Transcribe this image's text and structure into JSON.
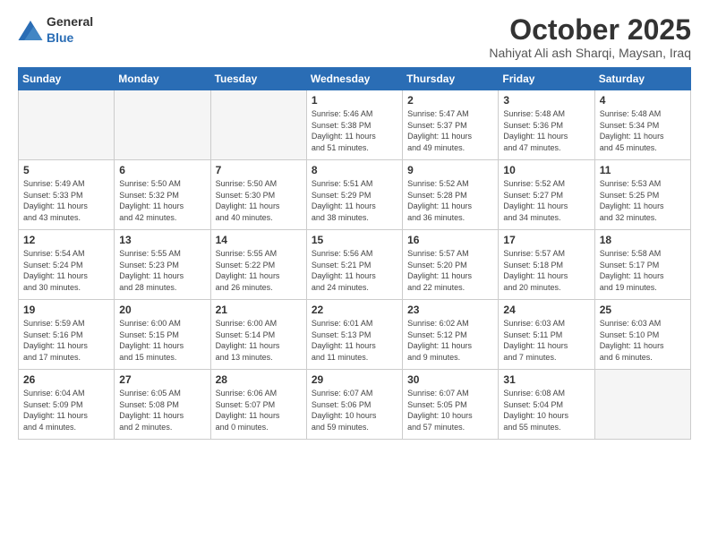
{
  "logo": {
    "text_general": "General",
    "text_blue": "Blue"
  },
  "title": "October 2025",
  "location": "Nahiyat Ali ash Sharqi, Maysan, Iraq",
  "weekdays": [
    "Sunday",
    "Monday",
    "Tuesday",
    "Wednesday",
    "Thursday",
    "Friday",
    "Saturday"
  ],
  "weeks": [
    [
      {
        "day": "",
        "info": ""
      },
      {
        "day": "",
        "info": ""
      },
      {
        "day": "",
        "info": ""
      },
      {
        "day": "1",
        "info": "Sunrise: 5:46 AM\nSunset: 5:38 PM\nDaylight: 11 hours\nand 51 minutes."
      },
      {
        "day": "2",
        "info": "Sunrise: 5:47 AM\nSunset: 5:37 PM\nDaylight: 11 hours\nand 49 minutes."
      },
      {
        "day": "3",
        "info": "Sunrise: 5:48 AM\nSunset: 5:36 PM\nDaylight: 11 hours\nand 47 minutes."
      },
      {
        "day": "4",
        "info": "Sunrise: 5:48 AM\nSunset: 5:34 PM\nDaylight: 11 hours\nand 45 minutes."
      }
    ],
    [
      {
        "day": "5",
        "info": "Sunrise: 5:49 AM\nSunset: 5:33 PM\nDaylight: 11 hours\nand 43 minutes."
      },
      {
        "day": "6",
        "info": "Sunrise: 5:50 AM\nSunset: 5:32 PM\nDaylight: 11 hours\nand 42 minutes."
      },
      {
        "day": "7",
        "info": "Sunrise: 5:50 AM\nSunset: 5:30 PM\nDaylight: 11 hours\nand 40 minutes."
      },
      {
        "day": "8",
        "info": "Sunrise: 5:51 AM\nSunset: 5:29 PM\nDaylight: 11 hours\nand 38 minutes."
      },
      {
        "day": "9",
        "info": "Sunrise: 5:52 AM\nSunset: 5:28 PM\nDaylight: 11 hours\nand 36 minutes."
      },
      {
        "day": "10",
        "info": "Sunrise: 5:52 AM\nSunset: 5:27 PM\nDaylight: 11 hours\nand 34 minutes."
      },
      {
        "day": "11",
        "info": "Sunrise: 5:53 AM\nSunset: 5:25 PM\nDaylight: 11 hours\nand 32 minutes."
      }
    ],
    [
      {
        "day": "12",
        "info": "Sunrise: 5:54 AM\nSunset: 5:24 PM\nDaylight: 11 hours\nand 30 minutes."
      },
      {
        "day": "13",
        "info": "Sunrise: 5:55 AM\nSunset: 5:23 PM\nDaylight: 11 hours\nand 28 minutes."
      },
      {
        "day": "14",
        "info": "Sunrise: 5:55 AM\nSunset: 5:22 PM\nDaylight: 11 hours\nand 26 minutes."
      },
      {
        "day": "15",
        "info": "Sunrise: 5:56 AM\nSunset: 5:21 PM\nDaylight: 11 hours\nand 24 minutes."
      },
      {
        "day": "16",
        "info": "Sunrise: 5:57 AM\nSunset: 5:20 PM\nDaylight: 11 hours\nand 22 minutes."
      },
      {
        "day": "17",
        "info": "Sunrise: 5:57 AM\nSunset: 5:18 PM\nDaylight: 11 hours\nand 20 minutes."
      },
      {
        "day": "18",
        "info": "Sunrise: 5:58 AM\nSunset: 5:17 PM\nDaylight: 11 hours\nand 19 minutes."
      }
    ],
    [
      {
        "day": "19",
        "info": "Sunrise: 5:59 AM\nSunset: 5:16 PM\nDaylight: 11 hours\nand 17 minutes."
      },
      {
        "day": "20",
        "info": "Sunrise: 6:00 AM\nSunset: 5:15 PM\nDaylight: 11 hours\nand 15 minutes."
      },
      {
        "day": "21",
        "info": "Sunrise: 6:00 AM\nSunset: 5:14 PM\nDaylight: 11 hours\nand 13 minutes."
      },
      {
        "day": "22",
        "info": "Sunrise: 6:01 AM\nSunset: 5:13 PM\nDaylight: 11 hours\nand 11 minutes."
      },
      {
        "day": "23",
        "info": "Sunrise: 6:02 AM\nSunset: 5:12 PM\nDaylight: 11 hours\nand 9 minutes."
      },
      {
        "day": "24",
        "info": "Sunrise: 6:03 AM\nSunset: 5:11 PM\nDaylight: 11 hours\nand 7 minutes."
      },
      {
        "day": "25",
        "info": "Sunrise: 6:03 AM\nSunset: 5:10 PM\nDaylight: 11 hours\nand 6 minutes."
      }
    ],
    [
      {
        "day": "26",
        "info": "Sunrise: 6:04 AM\nSunset: 5:09 PM\nDaylight: 11 hours\nand 4 minutes."
      },
      {
        "day": "27",
        "info": "Sunrise: 6:05 AM\nSunset: 5:08 PM\nDaylight: 11 hours\nand 2 minutes."
      },
      {
        "day": "28",
        "info": "Sunrise: 6:06 AM\nSunset: 5:07 PM\nDaylight: 11 hours\nand 0 minutes."
      },
      {
        "day": "29",
        "info": "Sunrise: 6:07 AM\nSunset: 5:06 PM\nDaylight: 10 hours\nand 59 minutes."
      },
      {
        "day": "30",
        "info": "Sunrise: 6:07 AM\nSunset: 5:05 PM\nDaylight: 10 hours\nand 57 minutes."
      },
      {
        "day": "31",
        "info": "Sunrise: 6:08 AM\nSunset: 5:04 PM\nDaylight: 10 hours\nand 55 minutes."
      },
      {
        "day": "",
        "info": ""
      }
    ]
  ]
}
